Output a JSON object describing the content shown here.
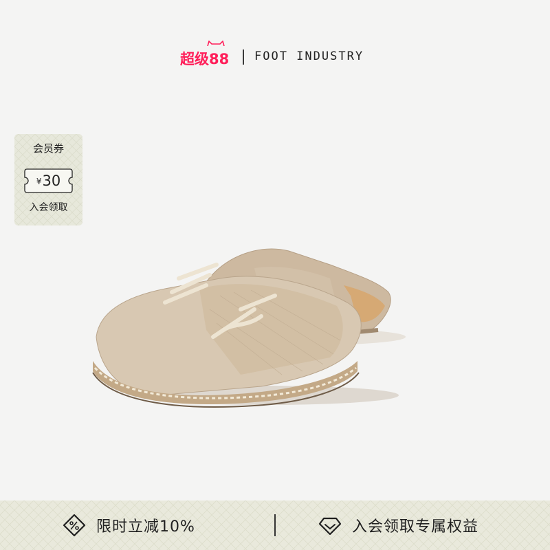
{
  "header": {
    "promo_logo": "超级88",
    "brand_name": "FOOT INDUSTRY"
  },
  "coupon": {
    "title": "会员券",
    "currency": "¥",
    "value": "30",
    "action": "入会领取"
  },
  "product": {
    "icon": "espadrille-mule-pair-image"
  },
  "bottom_bar": {
    "left_text": "限时立减10%",
    "left_icon": "discount-tag-icon",
    "right_text": "入会领取专属权益",
    "right_icon": "diamond-icon"
  },
  "colors": {
    "background": "#f4f4f3",
    "promo_red": "#ff1f5a",
    "coupon_bg": "#e7e8db",
    "bar_bg": "#e9e9dc"
  }
}
